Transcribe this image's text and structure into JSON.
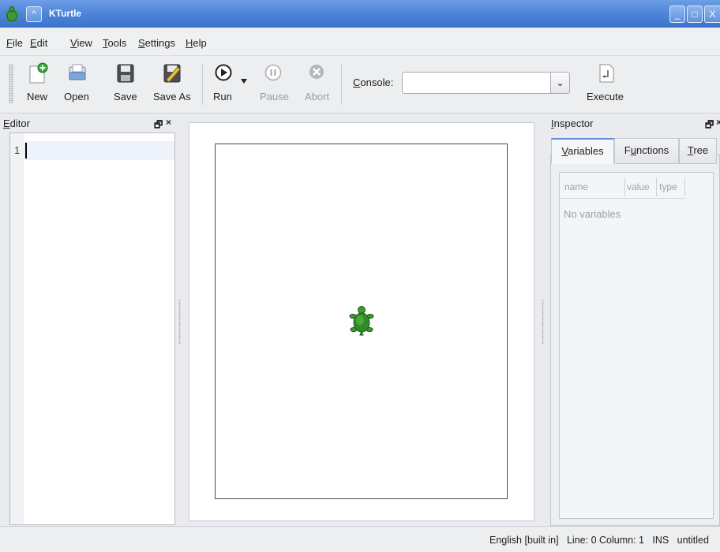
{
  "window": {
    "title": "KTurtle",
    "menu_glyph": "^",
    "minimize_glyph": "_",
    "maximize_glyph": "□",
    "close_glyph": "X"
  },
  "menubar": [
    {
      "accel": "F",
      "rest": "ile"
    },
    {
      "accel": "E",
      "rest": "dit"
    },
    {
      "accel": "V",
      "rest": "iew"
    },
    {
      "accel": "T",
      "rest": "ools"
    },
    {
      "accel": "S",
      "rest": "ettings"
    },
    {
      "accel": "H",
      "rest": "elp"
    }
  ],
  "toolbar": {
    "new": "New",
    "open": "Open",
    "save": "Save",
    "save_as": "Save As",
    "run": "Run",
    "pause": "Pause",
    "abort": "Abort",
    "console_accel": "C",
    "console_rest": "onsole:",
    "console_value": "",
    "dropdown_glyph": "⌄",
    "execute": "Execute"
  },
  "editor": {
    "title_accel": "E",
    "title_rest": "ditor",
    "float_glyph": "🗗",
    "close_glyph": "×",
    "line_number": "1"
  },
  "inspector": {
    "title_accel": "I",
    "title_rest": "nspector",
    "float_glyph": "🗗",
    "close_glyph": "×",
    "tabs": [
      {
        "accel": "V",
        "rest": "ariables"
      },
      {
        "pre": "F",
        "accel": "u",
        "rest": "nctions"
      },
      {
        "accel": "T",
        "rest": "ree"
      }
    ],
    "columns": [
      "name",
      "value",
      "type"
    ],
    "empty_message": "No variables"
  },
  "statusbar": {
    "language": "English [built in]",
    "position": "Line: 0 Column: 1",
    "mode": "INS",
    "file": "untitled"
  },
  "colors": {
    "titlebar": "#4a82d6",
    "turtle": "#2f8a2a",
    "tab_accent": "#5c8ed8"
  }
}
